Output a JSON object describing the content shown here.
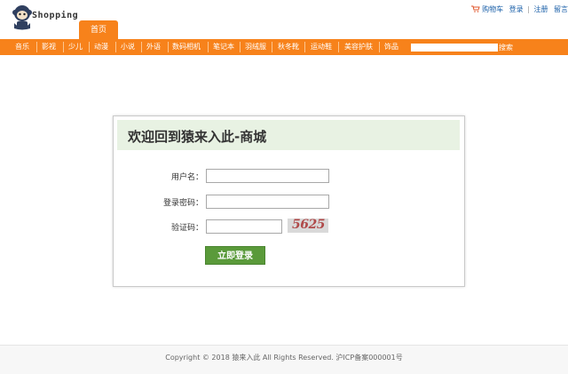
{
  "header": {
    "logo_text": "Shopping",
    "home_tab": "首页",
    "user_links": {
      "cart": "购物车",
      "login": "登录",
      "separator": "|",
      "register": "注册",
      "message": "留言"
    }
  },
  "nav": {
    "items": [
      "音乐",
      "影视",
      "少儿",
      "动漫",
      "小说",
      "外语",
      "数码相机",
      "笔记本",
      "羽绒服",
      "秋冬靴",
      "运动鞋",
      "美容护肤",
      "饰品"
    ],
    "search_value": "",
    "search_button": "搜索"
  },
  "login": {
    "title": "欢迎回到猿来入此-商城",
    "username_label": "用户名：",
    "username_value": "",
    "password_label": "登录密码：",
    "password_value": "",
    "captcha_label": "验证码：",
    "captcha_value": "",
    "captcha_image_text": "5625",
    "submit": "立即登录"
  },
  "footer": {
    "copyright": "Copyright © 2018 猿来入此 All Rights Reserved. 沪ICP备案000001号"
  },
  "colors": {
    "accent": "#f7821b",
    "login_button": "#5a9a3a",
    "login_header_bg": "#e8f2e3"
  },
  "icons": {
    "logo": "monkey-logo-icon",
    "cart": "shopping-cart-icon"
  }
}
